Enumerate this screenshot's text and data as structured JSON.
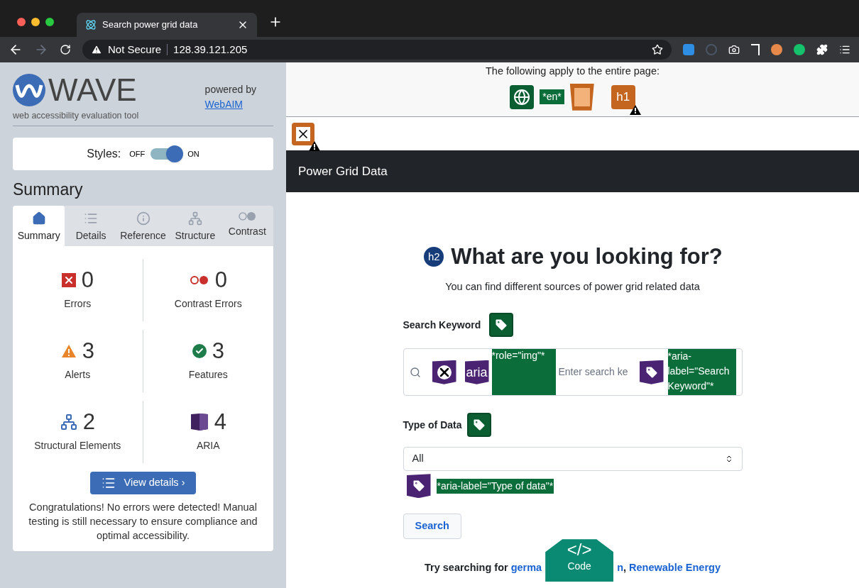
{
  "browser": {
    "tab_title": "Search power grid data",
    "security": "Not Secure",
    "url": "128.39.121.205"
  },
  "wave": {
    "logo": "WAVE",
    "tagline": "web accessibility evaluation tool",
    "powered_by": "powered by",
    "webaim_link": "WebAIM",
    "styles_label": "Styles:",
    "off_label": "OFF",
    "on_label": "ON",
    "styles_on": true,
    "heading": "Summary",
    "tabs": [
      {
        "label": "Summary",
        "kind": "home",
        "selected": true
      },
      {
        "label": "Details",
        "kind": "list",
        "selected": false
      },
      {
        "label": "Reference",
        "kind": "info",
        "selected": false
      },
      {
        "label": "Structure",
        "kind": "tree",
        "selected": false
      },
      {
        "label": "Contrast",
        "kind": "contrast",
        "selected": false
      }
    ],
    "stats": [
      {
        "kind": "error",
        "count": "0",
        "label": "Errors"
      },
      {
        "kind": "contrast",
        "count": "0",
        "label": "Contrast Errors"
      },
      {
        "kind": "alert",
        "count": "3",
        "label": "Alerts"
      },
      {
        "kind": "feature",
        "count": "3",
        "label": "Features"
      },
      {
        "kind": "structure",
        "count": "2",
        "label": "Structural Elements"
      },
      {
        "kind": "aria",
        "count": "4",
        "label": "ARIA"
      }
    ],
    "view_details": "View details ›",
    "message": "Congratulations! No errors were detected! Manual testing is still necessary to ensure compliance and optimal accessibility."
  },
  "page": {
    "entire_page_note": "The following apply to the entire page:",
    "lang_tag": "*en*",
    "h1_tag": "h1",
    "navbar_title": "Power Grid Data",
    "h2_tag": "h2",
    "heading": "What are you looking for?",
    "subtitle": "You can find different sources of power grid related data",
    "keyword_label": "Search Keyword",
    "aria_tag": "aria",
    "role_note": "*role=\"img\"*",
    "search_placeholder": "Enter search ke",
    "search_aria_note": "*aria-label=\"Search Keyword\"*",
    "type_label": "Type of Data",
    "type_value": "All",
    "type_aria_note": "*aria-label=\"Type of data\"*",
    "search_button": "Search",
    "try_prefix": "Try searching for",
    "links": [
      "germa",
      "n"
    ],
    "separator": ",",
    "last_link": "Renewable Energy",
    "code_symbol": "</>",
    "code_label": "Code"
  }
}
